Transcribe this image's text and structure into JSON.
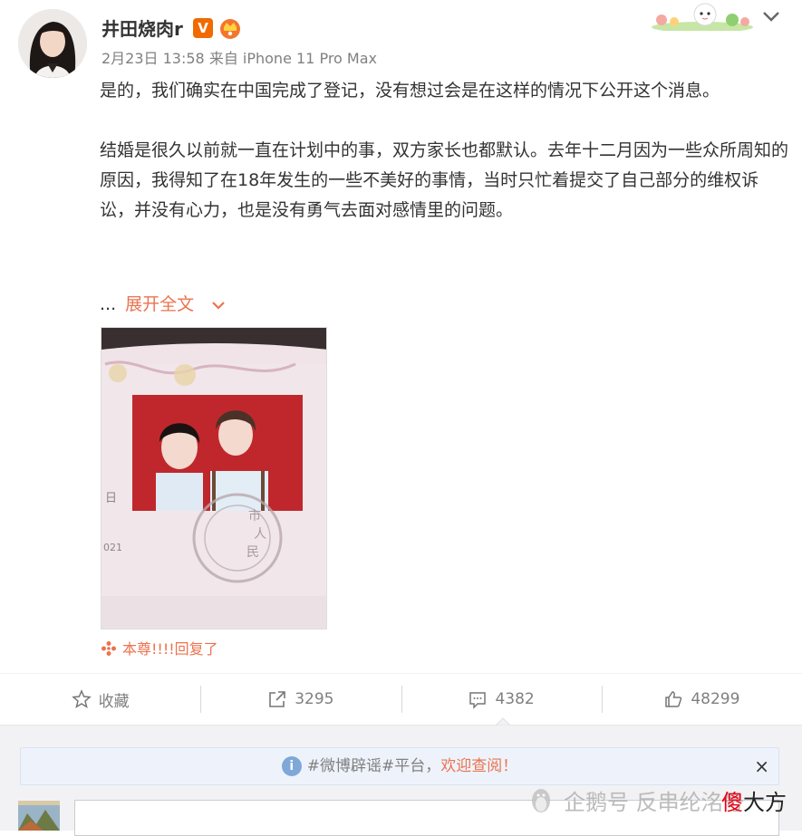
{
  "post": {
    "username": "井田烧肉r",
    "verified_badge": "V",
    "meta": "2月23日 13:58 来自 iPhone 11 Pro Max",
    "paragraphs": [
      "是的，我们确实在中国完成了登记，没有想过会是在这样的情况下公开这个消息。",
      "结婚是很久以前就一直在计划中的事，双方家长也都默认。去年十二月因为一些众所周知的原因，我得知了在18年发生的一些不美好的事情，当时只忙着提交了自己部分的维权诉讼，并没有心力，也是没有勇气去面对感情里的问题。"
    ],
    "ellipsis": "...",
    "expand_label": "展开全文",
    "photo_text": {
      "day": "日",
      "year": "021",
      "stamp_chars": [
        "市",
        "人",
        "民"
      ]
    },
    "reply_text": "本尊!!!!回复了"
  },
  "actions": [
    {
      "name": "favorite",
      "label": "收藏",
      "icon": "star-icon"
    },
    {
      "name": "repost",
      "label": "3295",
      "icon": "share-icon"
    },
    {
      "name": "comment",
      "label": "4382",
      "icon": "comment-icon"
    },
    {
      "name": "like",
      "label": "48299",
      "icon": "thumbs-up-icon"
    }
  ],
  "notice": {
    "info_glyph": "i",
    "prefix": "#微博辟谣#平台，",
    "link": "欢迎查阅！",
    "close": "×"
  },
  "watermark": {
    "text": "企鹅号 反串纶洺号",
    "brand_red": "傻",
    "brand_rest": "大方"
  },
  "colors": {
    "accent": "#eb7350",
    "verified": "#f06a00",
    "text": "#333333",
    "muted": "#808080",
    "notice_bg": "#eef3fb"
  }
}
